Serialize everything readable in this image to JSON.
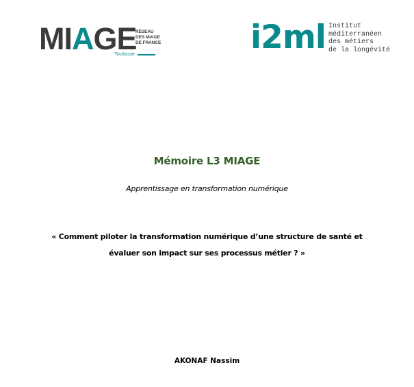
{
  "logos": {
    "miage": {
      "word_start": "MI",
      "word_accent": "A",
      "word_end": "GE",
      "network": "RÉSEAU\nDES MIAGE\nDE FRANCE",
      "city": "Toulouse"
    },
    "i2ml": {
      "word": "i2ml",
      "text": "Institut\nméditerranéen\ndes métiers\nde la longévité"
    }
  },
  "document": {
    "title": "Mémoire L3 MIAGE",
    "subtitle": "Apprentissage en transformation numérique",
    "question": "« Comment piloter la transformation numérique d’une structure de santé et évaluer son impact sur ses processus métier ? »",
    "author": "AKONAF Nassim"
  },
  "colors": {
    "teal": "#0b8a8e",
    "dark_grey": "#3b3b3b",
    "title_green": "#365f2c"
  }
}
